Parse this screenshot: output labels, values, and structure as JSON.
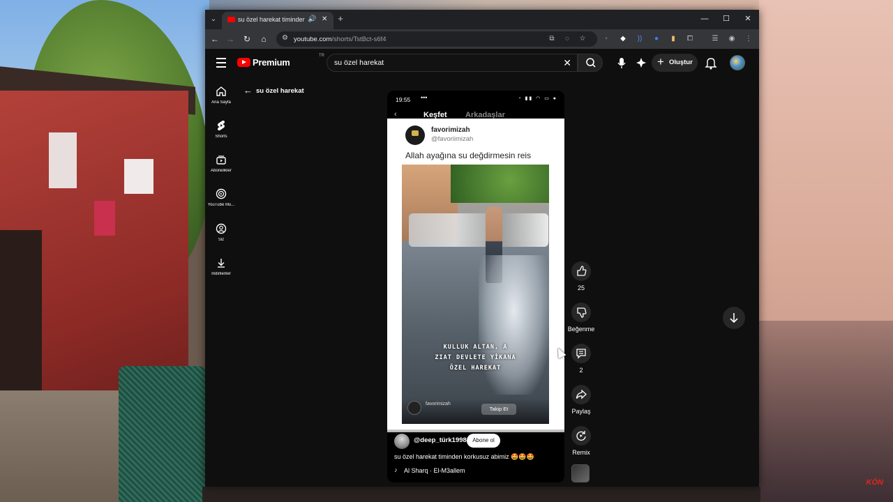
{
  "browser": {
    "tab_title": "su özel harekat timinden ko",
    "url_domain": "youtube.com",
    "url_path": "/shorts/TstBct-s6f4",
    "new_tab_glyph": "+",
    "tab_close_glyph": "✕"
  },
  "youtube": {
    "brand": "Premium",
    "region": "TR",
    "search_query": "su özel harekat",
    "create_label": "Oluştur",
    "back_label": "su özel harekat",
    "sidebar": [
      {
        "label": "Ana Sayfa",
        "icon": "home-icon"
      },
      {
        "label": "Shorts",
        "icon": "shorts-icon"
      },
      {
        "label": "Abonelikler",
        "icon": "subscriptions-icon"
      },
      {
        "label": "YouTube Mu...",
        "icon": "youtube-music-icon"
      },
      {
        "label": "Siz",
        "icon": "you-icon"
      },
      {
        "label": "İndirilenler",
        "icon": "downloads-icon"
      }
    ]
  },
  "video": {
    "phone_time": "19:55",
    "tiktok_tab_active": "Keşfet",
    "tiktok_tab_other": "Arkadaşlar",
    "post_name": "favorimizah",
    "post_handle": "@favoriimizah",
    "post_caption": "Allah ayağına su değdirmesin reis",
    "overlay_lines": [
      "KULLUK ALTAN, A",
      "ZIAT DEVLETE YİKANA",
      "ÖZEL HAREKAT"
    ],
    "inner_name": "favorimizah",
    "inner_follow": "Takip Et"
  },
  "shorts": {
    "channel": "@deep_türk1998",
    "subscribe_label": "Abone ol",
    "title": "su özel harekat timinden korkusuz abimiz 🤩🤩🤩",
    "music": "Al Sharq · El-M3allem",
    "like_count": "25",
    "dislike_label": "Beğenme",
    "comment_count": "2",
    "share_label": "Paylaş",
    "remix_label": "Remix"
  },
  "watermark": "KÖN"
}
